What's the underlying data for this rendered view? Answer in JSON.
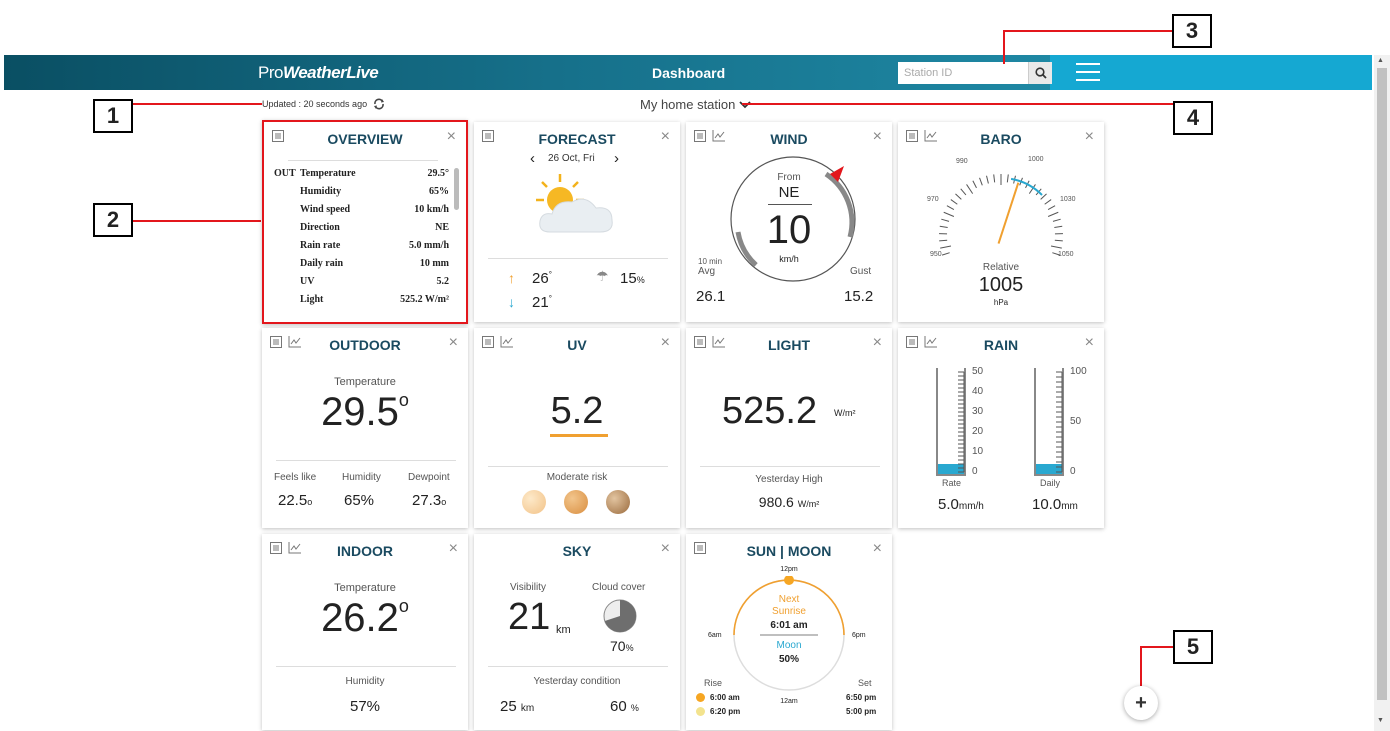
{
  "header": {
    "logo_pre": "Pro",
    "logo_main": "WeatherLive",
    "title": "Dashboard",
    "search_placeholder": "Station ID"
  },
  "status": {
    "updated": "Updated : 20 seconds ago"
  },
  "station": {
    "name": "My home station"
  },
  "callouts": [
    "1",
    "2",
    "3",
    "4",
    "5"
  ],
  "overview": {
    "title": "OVERVIEW",
    "prefix": "OUT",
    "rows": [
      {
        "label": "Temperature",
        "value": "29.5°"
      },
      {
        "label": "Humidity",
        "value": "65%"
      },
      {
        "label": "Wind speed",
        "value": "10 km/h"
      },
      {
        "label": "Direction",
        "value": "NE"
      },
      {
        "label": "Rain rate",
        "value": "5.0 mm/h"
      },
      {
        "label": "Daily rain",
        "value": "10 mm"
      },
      {
        "label": "UV",
        "value": "5.2"
      },
      {
        "label": "Light",
        "value": "525.2 W/m²"
      }
    ]
  },
  "forecast": {
    "title": "FORECAST",
    "date": "26 Oct, Fri",
    "high": "26",
    "low": "21",
    "high_unit": "°",
    "low_unit": "°",
    "rain": "15",
    "rain_unit": "%"
  },
  "wind": {
    "title": "WIND",
    "from_label": "From",
    "direction": "NE",
    "speed": "10",
    "unit": "km/h",
    "avg_label_1": "10 min",
    "avg_label_2": "Avg",
    "avg": "26.1",
    "gust_label": "Gust",
    "gust": "15.2"
  },
  "baro": {
    "title": "BARO",
    "ticks": [
      "990",
      "1000",
      "970",
      "1030",
      "950",
      "1050"
    ],
    "label": "Relative",
    "value": "1005",
    "unit": "hPa"
  },
  "outdoor": {
    "title": "OUTDOOR",
    "temp_label": "Temperature",
    "temp": "29.5",
    "deg": "o",
    "feels_label": "Feels like",
    "feels": "22.5",
    "feels_unit": "o",
    "hum_label": "Humidity",
    "hum": "65%",
    "dew_label": "Dewpoint",
    "dew": "27.3",
    "dew_unit": "o"
  },
  "uv": {
    "title": "UV",
    "value": "5.2",
    "risk": "Moderate risk"
  },
  "light": {
    "title": "LIGHT",
    "value": "525.2",
    "unit": "W/m²",
    "yh_label": "Yesterday High",
    "yh": "980.6",
    "yh_unit": "W/m²"
  },
  "rain": {
    "title": "RAIN",
    "rate_ticks": [
      "50",
      "40",
      "30",
      "20",
      "10",
      "0"
    ],
    "daily_ticks": [
      "100",
      "50",
      "0"
    ],
    "rate_label": "Rate",
    "rate": "5.0",
    "rate_unit": "mm/h",
    "daily_label": "Daily",
    "daily": "10.0",
    "daily_unit": "mm"
  },
  "indoor": {
    "title": "INDOOR",
    "temp_label": "Temperature",
    "temp": "26.2",
    "deg": "o",
    "hum_label": "Humidity",
    "hum": "57%"
  },
  "sky": {
    "title": "SKY",
    "vis_label": "Visibility",
    "vis": "21",
    "vis_unit": "km",
    "cloud_label": "Cloud cover",
    "cloud": "70",
    "cloud_unit": "%",
    "cloud_fraction": 0.7,
    "yc_label": "Yesterday condition",
    "yc_vis": "25",
    "yc_vis_unit": "km",
    "yc_cloud": "60",
    "yc_cloud_unit": "%"
  },
  "sunmoon": {
    "title": "SUN | MOON",
    "t12pm": "12pm",
    "t6am": "6am",
    "t6pm": "6pm",
    "t12am": "12am",
    "next": "Next",
    "sunrise": "Sunrise",
    "sunrise_time": "6:01 am",
    "moon": "Moon",
    "moon_pct": "50%",
    "rise_label": "Rise",
    "set_label": "Set",
    "sun_rise": "6:00 am",
    "sun_set": "6:50 pm",
    "moon_rise": "6:20 pm",
    "moon_set": "5:00 pm"
  },
  "colors": {
    "accent": "#15a8d2",
    "callout_line": "#e3161c",
    "title": "#1a4a60",
    "orange": "#f0a030",
    "blue": "#29a8d0"
  },
  "icons": [
    "refresh-icon",
    "chevron-down-icon",
    "search-icon",
    "hamburger-icon",
    "list-icon",
    "chart-icon",
    "close-icon",
    "plus-icon"
  ]
}
